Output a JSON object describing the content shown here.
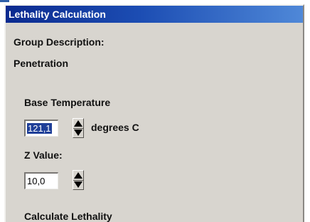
{
  "window": {
    "title": "Lethality Calculation"
  },
  "group": {
    "description_label": "Group Description:",
    "value": "Penetration"
  },
  "base_temperature": {
    "label": "Base Temperature",
    "value": "121,1",
    "unit": "degrees C"
  },
  "z_value": {
    "label": "Z Value:",
    "value": "10,0"
  },
  "calculate": {
    "label": "Calculate Lethality"
  },
  "colors": {
    "title_bar": "#1c4db3",
    "panel": "#d8d5cf",
    "selection": "#1f3f98"
  },
  "icons": {
    "spinner_up": "triangle-up-icon",
    "spinner_down": "triangle-down-icon"
  }
}
